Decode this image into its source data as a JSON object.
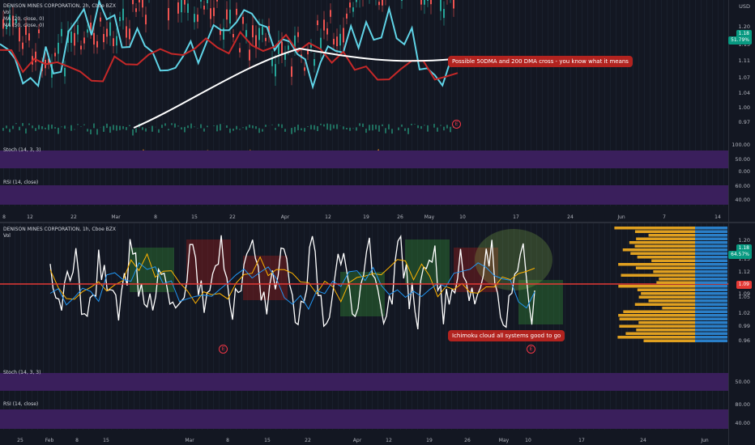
{
  "top": {
    "legend": {
      "symbol": "DENISON MINES CORPORATION, 2h, Cboe BZX",
      "vol": "Vol",
      "ma20": "MA (20, close, 0)",
      "ma50": "MA (50, close, 0)"
    },
    "currency": "USD",
    "price_ticks": [
      "1.20",
      "1.15",
      "1.11",
      "1.07",
      "1.04",
      "1.00",
      "0.97"
    ],
    "price_tag": "1.18",
    "change_tag": "51.79%",
    "callout": "Possible 50DMA and 200 DMA cross - you know what it means",
    "stoch_label": "Stoch (14, 3, 3)",
    "stoch_ticks": [
      "100.00",
      "50.00",
      "0.00"
    ],
    "rsi_label": "RSI (14, close)",
    "rsi_ticks": [
      "60.00",
      "40.00"
    ],
    "time_ticks": [
      "8",
      "12",
      "22",
      "Mar",
      "8",
      "15",
      "22",
      "Apr",
      "12",
      "19",
      "26",
      "May",
      "10",
      "17",
      "24",
      "Jun",
      "7",
      "14"
    ]
  },
  "bottom": {
    "legend": {
      "symbol": "DENISON MINES CORPORATION, 1h, Cboe BZX",
      "vol": "Vol"
    },
    "price_ticks": [
      "1.20",
      "1.15",
      "1.12",
      "1.09",
      "1.05",
      "1.02",
      "0.99",
      "0.96"
    ],
    "price_tag": "1.18",
    "change_tag": "64.57%",
    "level_tag": "1.09",
    "callout": "Ichimoku cloud all systems good to go",
    "stoch_label": "Stoch (14, 3, 3)",
    "stoch_ticks": [
      "50.00"
    ],
    "rsi_label": "RSI (14, close)",
    "rsi_ticks": [
      "80.00",
      "40.00"
    ],
    "time_ticks": [
      "25",
      "Feb",
      "8",
      "15",
      "Mar",
      "8",
      "15",
      "22",
      "Apr",
      "12",
      "19",
      "26",
      "May",
      "10",
      "17",
      "24",
      "Jun"
    ]
  },
  "colors": {
    "background": "#131722",
    "ma_fast": "#5fd3e6",
    "ma_slow": "#c62828",
    "ma_long": "#ffffff",
    "stoch": "#f08a24",
    "rsi": "#e6b422",
    "callout": "#b2231f",
    "horizontal_level": "#e53935"
  }
}
